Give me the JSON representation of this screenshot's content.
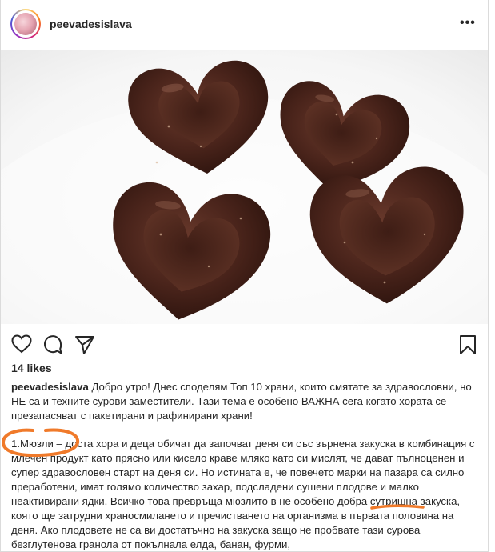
{
  "post": {
    "username": "peevadesislava",
    "more_label": "•••",
    "likes": "14 likes",
    "caption_user": "peevadesislava",
    "caption_intro": "Добро утро! Днес споделям Топ 10 храни, които смятате за здравословни, но НЕ са и техните сурови заместители. Тази тема е особено ВАЖНА сега когато хората се презапасяват с пакетирани и рафинирани храни!",
    "paragraph_1": "1.Мюзли – доста хора и деца обичат да започват деня си със зърнена закуска в комбинация с млечен продукт като прясно или кисело краве мляко като си мислят, че дават пълноценен и супер здравословен старт на деня си. Но истината е, че повечето марки на пазара са силно преработени, имат голямо количество захар, подсладени сушени плодове и малко неактивирани ядки. Всичко това превръща мюзлито в не особено добра сутришна закуска, която ще затрудни храносмилането и пречистването на организма в първата половина на деня. Ако плодовете не са ви достатъчно на закуска защо не пробвате тази сурова безглутенова гранола от покълнала елда, банан, фурми,"
  },
  "icons": {
    "like": "heart-icon",
    "comment": "comment-icon",
    "share": "share-icon",
    "save": "bookmark-icon",
    "more": "more-options-icon"
  },
  "colors": {
    "annotation": "#f07a2a",
    "text": "#262626",
    "border": "#dbdbdb"
  }
}
